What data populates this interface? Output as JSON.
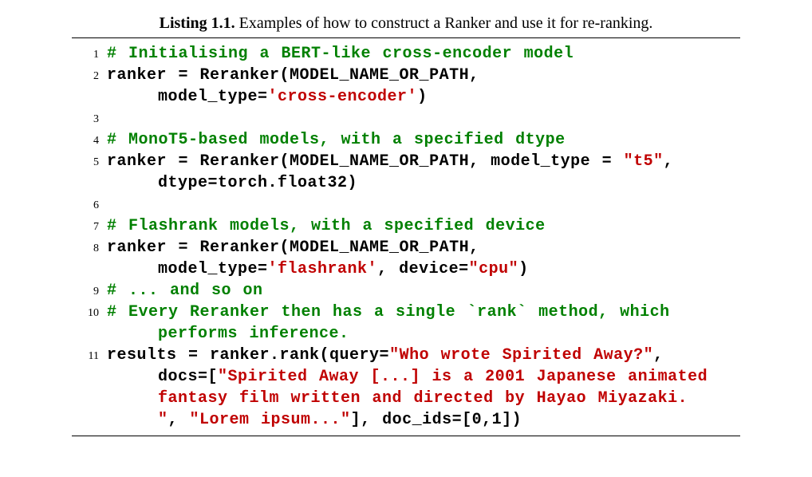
{
  "caption": {
    "label": "Listing 1.1.",
    "text": "Examples of how to construct a Ranker and use it for re-ranking."
  },
  "lines": {
    "l1": "# Initialising a BERT-like cross-encoder model",
    "l2a": "ranker = Reranker(MODEL_NAME_OR_PATH,",
    "l2b_pre": "model_type=",
    "l2b_str": "'cross-encoder'",
    "l2b_post": ")",
    "l4": "# MonoT5-based models, with a specified dtype",
    "l5a_pre": "ranker = Reranker(MODEL_NAME_OR_PATH, model_type = ",
    "l5a_str": "\"t5\"",
    "l5a_post": ",",
    "l5b": "dtype=torch.float32)",
    "l7": "# Flashrank models, with a specified device",
    "l8a": "ranker = Reranker(MODEL_NAME_OR_PATH,",
    "l8b_pre": "model_type=",
    "l8b_str1": "'flashrank'",
    "l8b_mid": ", device=",
    "l8b_str2": "\"cpu\"",
    "l8b_post": ")",
    "l9": "# ... and so on",
    "l10a": "# Every Reranker then has a single `rank` method, which",
    "l10b": "performs inference.",
    "l11a_pre": "results = ranker.rank(query=",
    "l11a_str": "\"Who wrote Spirited Away?\"",
    "l11a_post": ",",
    "l11b_pre": "docs=[",
    "l11b_str": "\"Spirited Away [...] is a 2001 Japanese animated",
    "l11c_str": "fantasy film written and directed by Hayao Miyazaki.",
    "l11d_str1": "\"",
    "l11d_mid": ", ",
    "l11d_str2": "\"Lorem ipsum...\"",
    "l11d_post": "], doc_ids=[0,1])"
  },
  "nums": {
    "n1": "1",
    "n2": "2",
    "n3": "3",
    "n4": "4",
    "n5": "5",
    "n6": "6",
    "n7": "7",
    "n8": "8",
    "n9": "9",
    "n10": "10",
    "n11": "11"
  }
}
